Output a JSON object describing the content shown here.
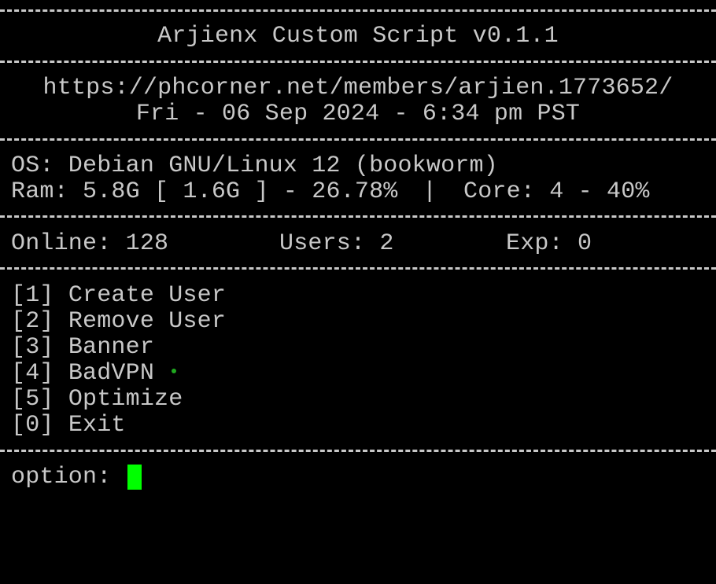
{
  "colors": {
    "background": "#000000",
    "text": "#c8c8c8",
    "status_dot": "#1fa81f",
    "cursor": "#00ff00"
  },
  "header": {
    "title": "Arjienx Custom Script v0.1.1",
    "url": "https://phcorner.net/members/arjien.1773652/",
    "datetime": "Fri - 06 Sep 2024 - 6:34 pm PST"
  },
  "system": {
    "os": "OS: Debian GNU/Linux 12 (bookworm)",
    "ram": "Ram: 5.8G [ 1.6G ] - 26.78%",
    "divider": "|",
    "core": "Core: 4 - 40%"
  },
  "stats": {
    "online": "Online: 128",
    "users": "Users: 2",
    "exp": "Exp: 0"
  },
  "menu": {
    "items": [
      {
        "key": "[1]",
        "label": "Create User"
      },
      {
        "key": "[2]",
        "label": "Remove User"
      },
      {
        "key": "[3]",
        "label": "Banner"
      },
      {
        "key": "[4]",
        "label": "BadVPN",
        "status_icon": "status-dot-icon"
      },
      {
        "key": "[5]",
        "label": "Optimize"
      },
      {
        "key": "[0]",
        "label": "Exit"
      }
    ]
  },
  "prompt": {
    "label": "option:",
    "input_value": "",
    "cursor_icon": "block-cursor-icon"
  }
}
